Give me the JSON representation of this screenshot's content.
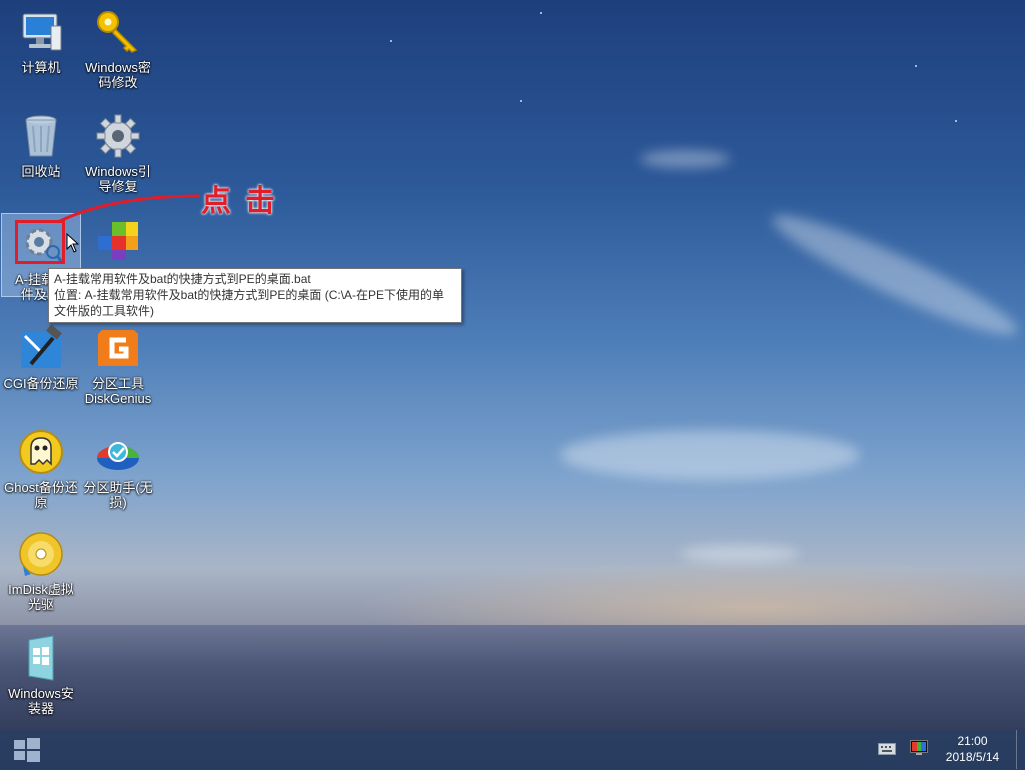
{
  "desktop": {
    "icons": [
      {
        "label": "计算机",
        "icon": "computer-icon"
      },
      {
        "label": "Windows密码修改",
        "icon": "key-icon"
      },
      {
        "label": "回收站",
        "icon": "recycle-bin-icon"
      },
      {
        "label": "Windows引导修复",
        "icon": "gear-icon"
      },
      {
        "label": "A-挂载常用软件及bat",
        "icon": "gear-search-icon"
      },
      {
        "label": "",
        "icon": "registry-cubes-icon"
      },
      {
        "label": "CGI备份还原",
        "icon": "cgi-hammer-icon"
      },
      {
        "label": "分区工具DiskGenius",
        "icon": "diskgenius-icon"
      },
      {
        "label": "Ghost备份还原",
        "icon": "ghost-icon"
      },
      {
        "label": "分区助手(无损)",
        "icon": "partition-assistant-icon"
      },
      {
        "label": "ImDisk虚拟光驱",
        "icon": "cd-icon"
      },
      {
        "label": "Windows安装器",
        "icon": "windows-installer-icon"
      }
    ]
  },
  "icon_labels": {
    "i0": "计算机",
    "i1a": "Windows密",
    "i1b": "码修改",
    "i2": "回收站",
    "i3a": "Windows引",
    "i3b": "导修复",
    "i4a": "A-挂载常",
    "i4b": "件及ba",
    "i6": "CGI备份还原",
    "i7a": "分区工具",
    "i7b": "DiskGenius",
    "i8a": "Ghost备份还",
    "i8b": "原",
    "i9a": "分区助手(无",
    "i9b": "损)",
    "i10a": "ImDisk虚拟",
    "i10b": "光驱",
    "i11a": "Windows安",
    "i11b": "装器"
  },
  "tooltip": {
    "line1": "A-挂载常用软件及bat的快捷方式到PE的桌面.bat",
    "line2": "位置: A-挂载常用软件及bat的快捷方式到PE的桌面 (C:\\A-在PE下使用的单",
    "line3": "文件版的工具软件)"
  },
  "annotation": {
    "text": "点击",
    "color": "#e11d2a"
  },
  "taskbar": {
    "start": "windows-start-icon",
    "time": "21:00",
    "date": "2018/5/14"
  },
  "colors": {
    "accent": "#e11d2a",
    "taskbar": "#283e62"
  }
}
